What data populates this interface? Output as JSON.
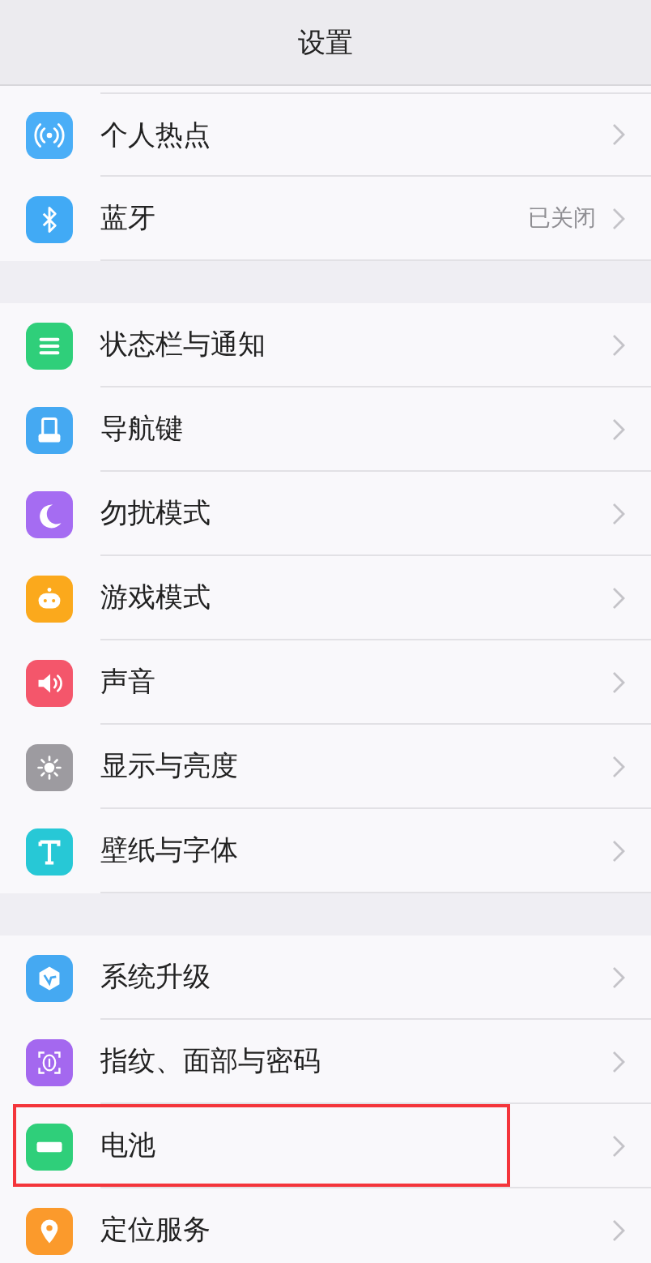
{
  "header": {
    "title": "设置"
  },
  "groups": [
    {
      "items": [
        {
          "kind": "hotspot",
          "label": "个人热点",
          "highlighted": false
        },
        {
          "kind": "bluetooth",
          "label": "蓝牙",
          "value": "已关闭",
          "highlighted": false
        }
      ]
    },
    {
      "items": [
        {
          "kind": "statusbar",
          "label": "状态栏与通知",
          "highlighted": false
        },
        {
          "kind": "navkey",
          "label": "导航键",
          "highlighted": false
        },
        {
          "kind": "dnd",
          "label": "勿扰模式",
          "highlighted": false
        },
        {
          "kind": "game",
          "label": "游戏模式",
          "highlighted": false
        },
        {
          "kind": "sound",
          "label": "声音",
          "highlighted": false
        },
        {
          "kind": "display",
          "label": "显示与亮度",
          "highlighted": false
        },
        {
          "kind": "wallpaper",
          "label": "壁纸与字体",
          "highlighted": false
        }
      ]
    },
    {
      "items": [
        {
          "kind": "update",
          "label": "系统升级",
          "highlighted": false
        },
        {
          "kind": "fingerprint",
          "label": "指纹、面部与密码",
          "highlighted": false
        },
        {
          "kind": "battery",
          "label": "电池",
          "highlighted": true
        },
        {
          "kind": "location",
          "label": "定位服务",
          "highlighted": false
        }
      ]
    }
  ]
}
